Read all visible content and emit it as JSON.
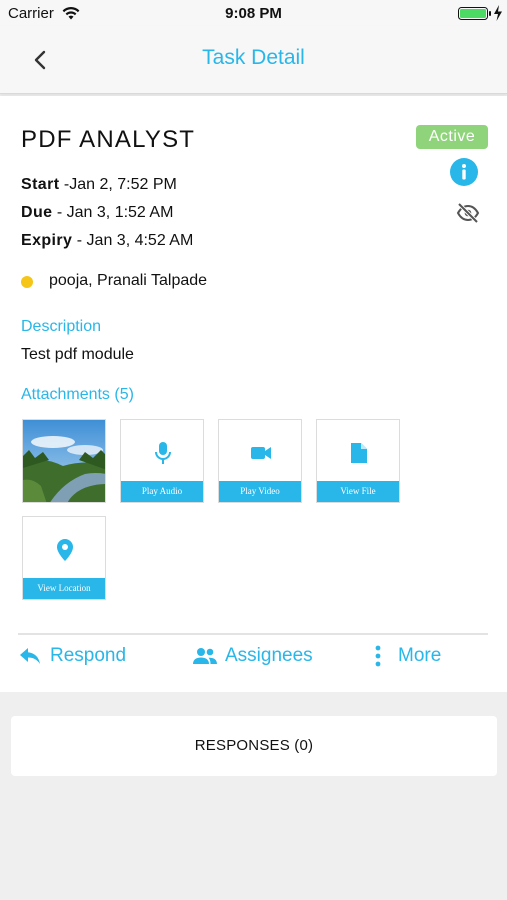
{
  "status_bar": {
    "carrier": "Carrier",
    "time": "9:08 PM"
  },
  "nav": {
    "title": "Task Detail",
    "back_icon": "chevron-left-icon"
  },
  "task": {
    "title": "PDF ANALYST",
    "status": "Active",
    "start_label": "Start",
    "start_value": " -Jan 2, 7:52 PM",
    "due_label": "Due",
    "due_value": " - Jan 3, 1:52 AM",
    "expiry_label": "Expiry",
    "expiry_value": " - Jan 3, 4:52 AM",
    "assignees": "pooja, Pranali Talpade",
    "description_label": "Description",
    "description": "Test pdf module",
    "attachments_label": "Attachments (5)"
  },
  "attachments": {
    "audio": "Play Audio",
    "video": "Play Video",
    "file": "View File",
    "location": "View Location"
  },
  "actions": {
    "respond": "Respond",
    "assignees": "Assignees",
    "more": "More"
  },
  "responses_label": "RESPONSES (0)",
  "colors": {
    "accent": "#29b6e8",
    "active_badge": "#8fd47b",
    "assignee_dot": "#f5c518",
    "battery": "#4cd964"
  }
}
